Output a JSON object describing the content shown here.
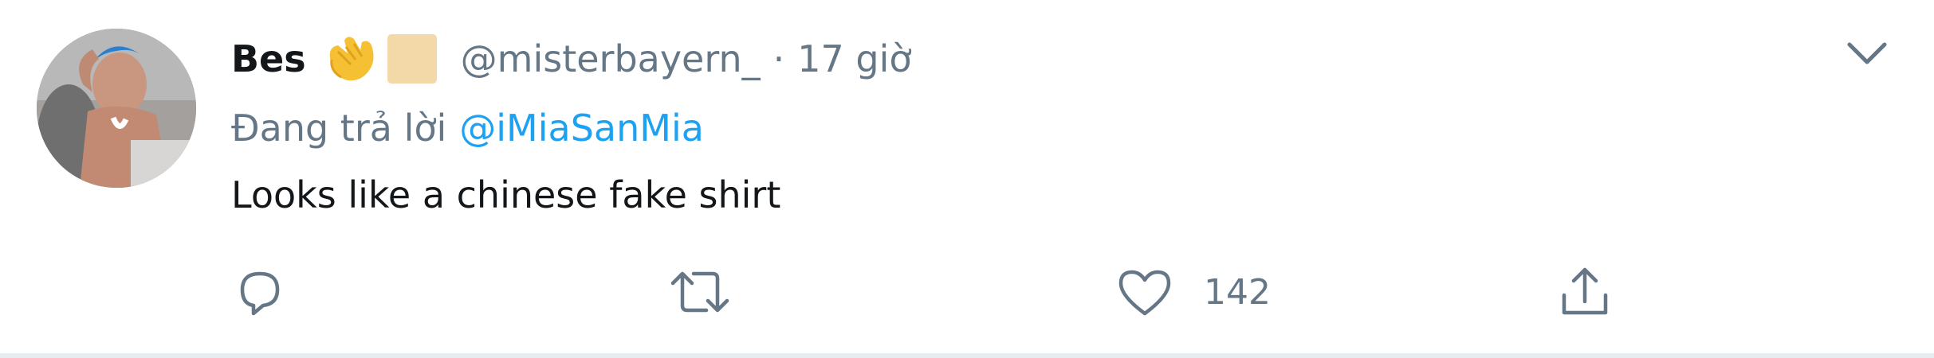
{
  "tweet": {
    "display_name": "Bes",
    "handle": "@misterbayern_",
    "separator": "·",
    "time": "17 giờ",
    "reply_prefix": "Đang trả lời",
    "reply_mention": "@iMiaSanMia",
    "text": "Looks like a chinese fake shirt",
    "emojis": [
      "clapping-hands-emoji",
      "skin-tone-modifier-emoji"
    ]
  },
  "actions": {
    "reply_icon": "speech-bubble-icon",
    "retweet_icon": "retweet-arrows-icon",
    "like_icon": "heart-icon",
    "like_count": "142",
    "share_icon": "share-upload-icon",
    "menu_icon": "chevron-down-icon"
  },
  "colors": {
    "text_primary": "#14171a",
    "text_secondary": "#657786",
    "link": "#1da1f2",
    "divider": "#e6ecf0"
  }
}
